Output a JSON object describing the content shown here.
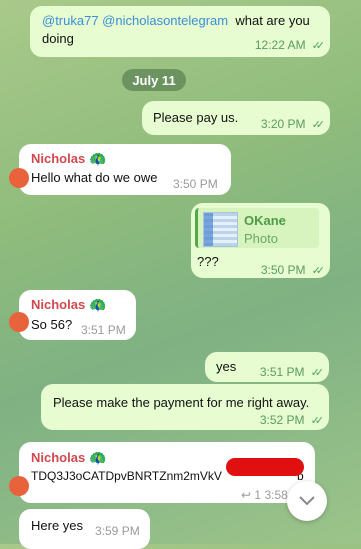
{
  "messages": [
    {
      "mentions": "@truka77 @nicholasontelegram",
      "text": "what are you doing",
      "line2": "doing",
      "time": "12:22 AM"
    },
    {
      "text": "Please pay us.",
      "time": "3:20 PM"
    },
    {
      "sender": "Nicholas",
      "text": "Hello what do we owe",
      "time": "3:50 PM"
    },
    {
      "photo_title": "OKane",
      "photo_sub": "Photo",
      "text": "???",
      "time": "3:50 PM"
    },
    {
      "sender": "Nicholas",
      "text": "So 56?",
      "time": "3:51 PM"
    },
    {
      "text": "yes",
      "time": "3:51 PM"
    },
    {
      "text": "Please make the payment for me right away.",
      "time": "3:52 PM"
    },
    {
      "sender": "Nicholas",
      "text": "TDQ3J3oCATDpvBNRTZnm2mVkV",
      "tail": "b",
      "reply_count": "1",
      "time": "3:58"
    },
    {
      "text": "Here yes",
      "time": "3:59 PM"
    }
  ],
  "date_separator": "July 11",
  "reply_icon": "reply-arrow-icon",
  "scroll_button_icon": "chevron-down-icon",
  "colors": {
    "accent": "#4aa55a",
    "sender": "#d1484f",
    "mention": "#3a8fd6",
    "redaction": "#e11010"
  }
}
